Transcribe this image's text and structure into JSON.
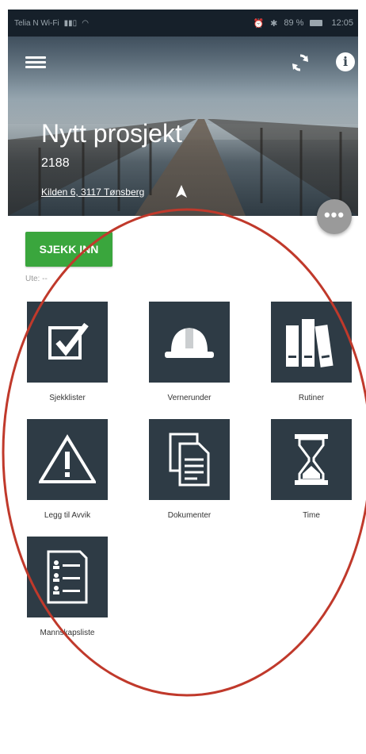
{
  "status_bar": {
    "carrier": "Telia N Wi-Fi",
    "battery": "89 %",
    "time": "12:05"
  },
  "header": {
    "project_title": "Nytt prosjekt",
    "project_number": "2188",
    "address": "Kilden 6, 3117 Tønsberg"
  },
  "actions": {
    "checkin_label": "SJEKK INN",
    "status_text": "Ute: --"
  },
  "tiles": [
    {
      "label": "Sjekklister",
      "icon": "checkbox-icon"
    },
    {
      "label": "Vernerunder",
      "icon": "hardhat-icon"
    },
    {
      "label": "Rutiner",
      "icon": "binders-icon"
    },
    {
      "label": "Legg til Avvik",
      "icon": "warning-icon"
    },
    {
      "label": "Dokumenter",
      "icon": "documents-icon"
    },
    {
      "label": "Time",
      "icon": "hourglass-icon"
    },
    {
      "label": "Mannskapsliste",
      "icon": "crew-list-icon"
    }
  ],
  "colors": {
    "tile": "#2e3b45",
    "checkin": "#3aa63d",
    "annotation": "#c0392b"
  }
}
